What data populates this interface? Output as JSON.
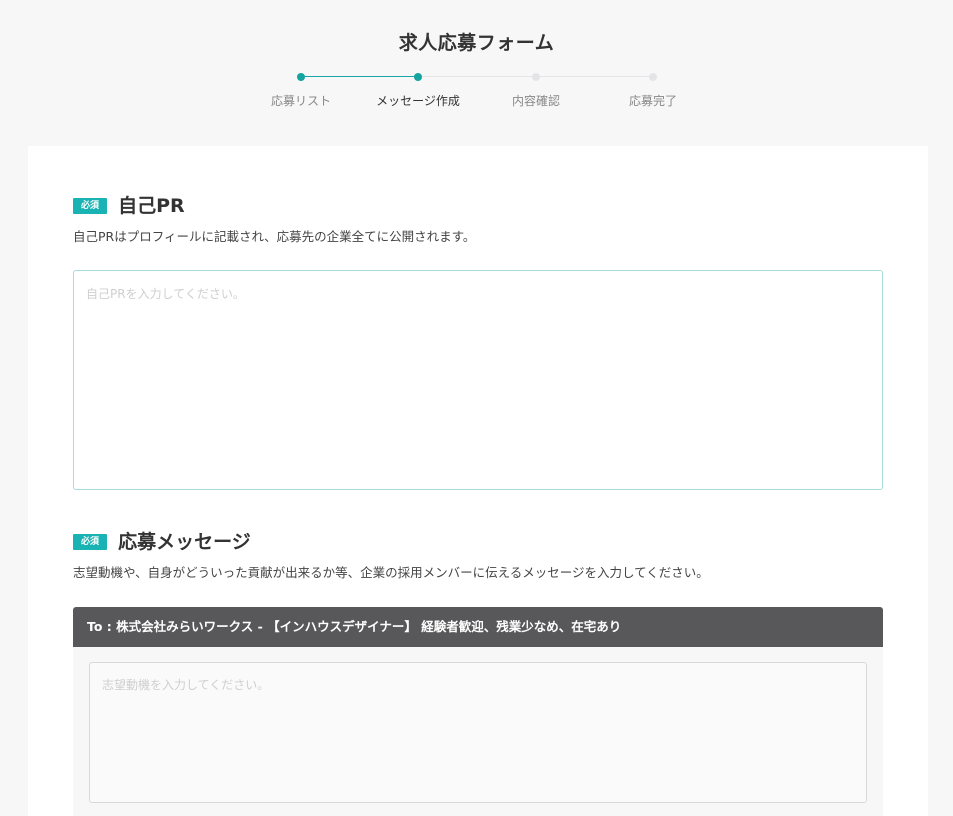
{
  "page": {
    "title": "求人応募フォーム"
  },
  "stepper": {
    "steps": [
      {
        "label": "応募リスト",
        "state": "done"
      },
      {
        "label": "メッセージ作成",
        "state": "current"
      },
      {
        "label": "内容確認",
        "state": "todo"
      },
      {
        "label": "応募完了",
        "state": "todo"
      }
    ]
  },
  "colors": {
    "accent": "#14a39e",
    "badge": "#19b3b3",
    "header_bar": "#58585a",
    "background": "#f7f7f8"
  },
  "pr_section": {
    "badge": "必須",
    "title": "自己PR",
    "description": "自己PRはプロフィールに記載され、応募先の企業全てに公開されます。",
    "placeholder": "自己PRを入力してください。",
    "value": ""
  },
  "message_section": {
    "badge": "必須",
    "title": "応募メッセージ",
    "description": "志望動機や、自身がどういった貢献が出来るか等、企業の採用メンバーに伝えるメッセージを入力してください。",
    "to_line": "To : 株式会社みらいワークス - 【インハウスデザイナー】 経験者歓迎、残業少なめ、在宅あり",
    "placeholder": "志望動機を入力してください。",
    "value": ""
  }
}
